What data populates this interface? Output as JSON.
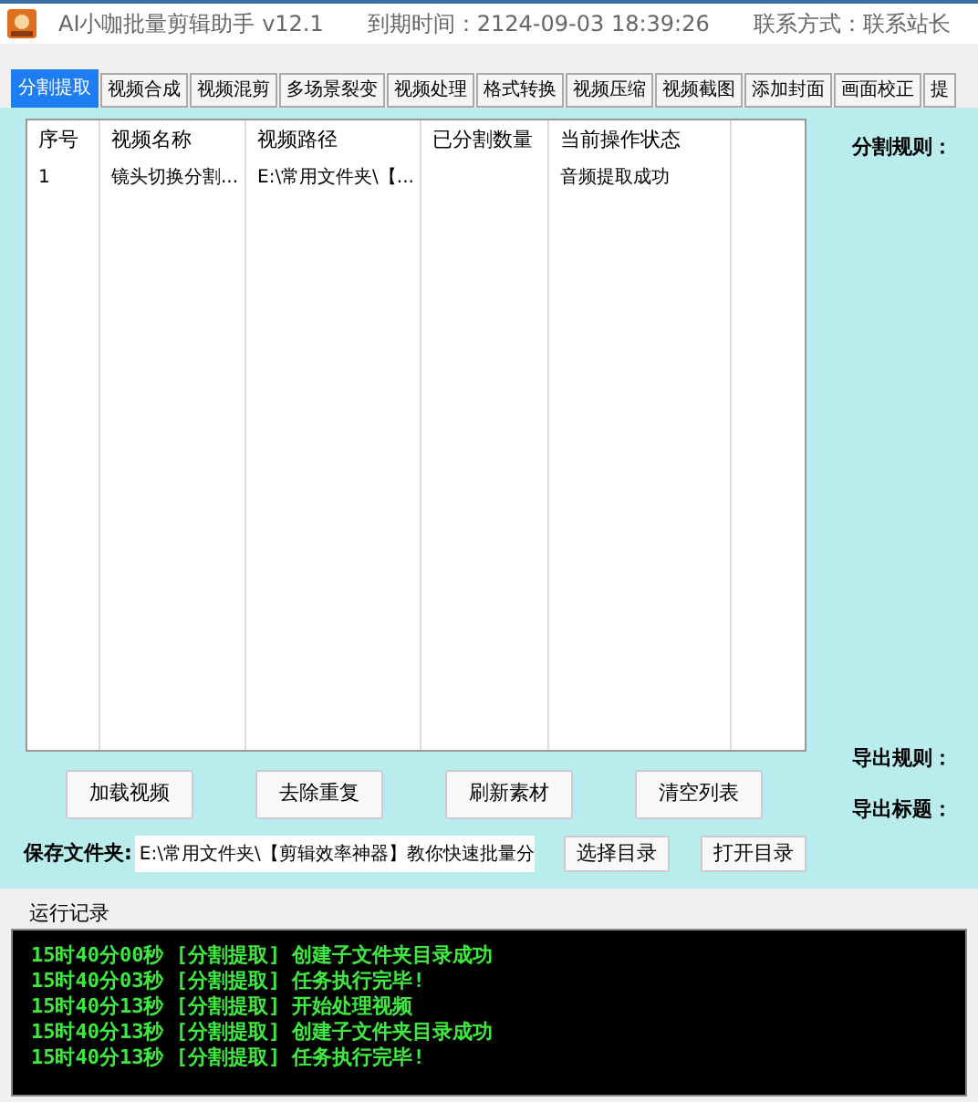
{
  "window": {
    "title": "AI小咖批量剪辑助手 v12.1",
    "expiry": "到期时间：2124-09-03 18:39:26",
    "contact": "联系方式：联系站长"
  },
  "tabs": [
    {
      "label": "分割提取",
      "selected": true
    },
    {
      "label": "视频合成",
      "selected": false
    },
    {
      "label": "视频混剪",
      "selected": false
    },
    {
      "label": "多场景裂变",
      "selected": false
    },
    {
      "label": "视频处理",
      "selected": false
    },
    {
      "label": "格式转换",
      "selected": false
    },
    {
      "label": "视频压缩",
      "selected": false
    },
    {
      "label": "视频截图",
      "selected": false
    },
    {
      "label": "添加封面",
      "selected": false
    },
    {
      "label": "画面校正",
      "selected": false
    },
    {
      "label": "提",
      "selected": false
    }
  ],
  "table": {
    "columns": [
      "序号",
      "视频名称",
      "视频路径",
      "已分割数量",
      "当前操作状态"
    ],
    "rows": [
      [
        "1",
        "镜头切换分割...",
        "E:\\常用文件夹\\【...",
        "",
        "音频提取成功"
      ]
    ]
  },
  "side_labels": [
    "分割规则：",
    "导出规则：",
    "导出标题："
  ],
  "buttons": [
    "加载视频",
    "去除重复",
    "刷新素材",
    "清空列表"
  ],
  "save_folder": {
    "label": "保存文件夹:",
    "value": "E:\\常用文件夹\\【剪辑效率神器】教你快速批量分",
    "buttons": [
      "选择目录",
      "打开目录"
    ]
  },
  "log": {
    "title": "运行记录",
    "lines": [
      "15时40分00秒 [分割提取] 创建子文件夹目录成功",
      "15时40分03秒 [分割提取] 任务执行完毕!",
      "15时40分13秒 [分割提取] 开始处理视频",
      "15时40分13秒 [分割提取] 创建子文件夹目录成功",
      "15时40分13秒 [分割提取] 任务执行完毕!"
    ]
  }
}
